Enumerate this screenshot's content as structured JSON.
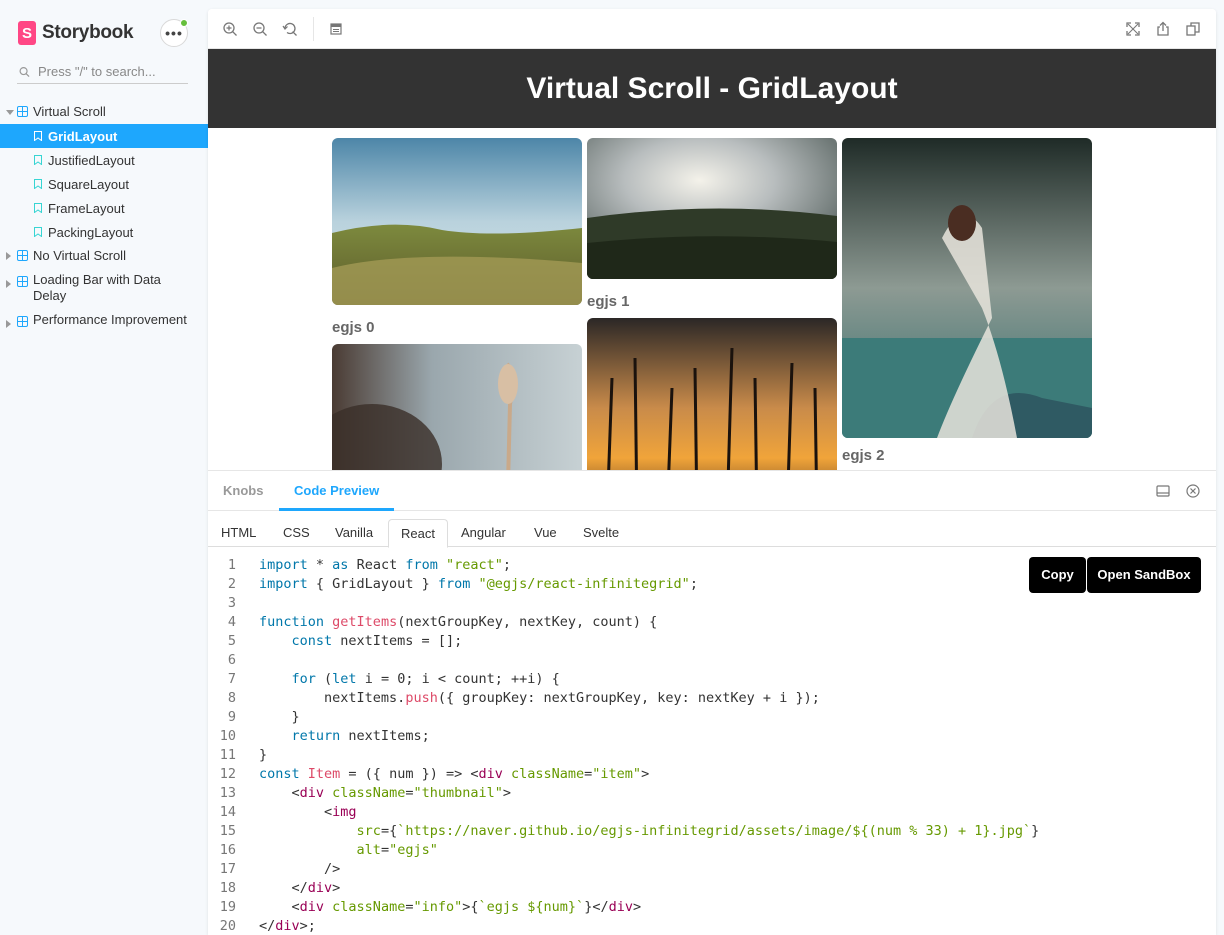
{
  "sidebar": {
    "brand": "Storybook",
    "brand_letter": "S",
    "menu_label": "•••",
    "search_placeholder": "Press \"/\" to search...",
    "groups": [
      {
        "label": "Virtual Scroll",
        "expanded": true,
        "stories": [
          "GridLayout",
          "JustifiedLayout",
          "SquareLayout",
          "FrameLayout",
          "PackingLayout"
        ]
      },
      {
        "label": "No Virtual Scroll",
        "expanded": false
      },
      {
        "label": "Loading Bar with Data Delay",
        "expanded": false
      },
      {
        "label": "Performance Improvement",
        "expanded": false
      }
    ],
    "active_story": "GridLayout"
  },
  "toolbar": {
    "left": [
      "zoom-in-icon",
      "zoom-out-icon",
      "zoom-reset-icon",
      "background-icon"
    ],
    "right": [
      "fullscreen-icon",
      "share-icon",
      "copy-link-icon"
    ]
  },
  "preview": {
    "title": "Virtual Scroll - GridLayout",
    "items": [
      {
        "info": "egjs 0"
      },
      {
        "info": "egjs 1"
      },
      {
        "info": "egjs 2"
      },
      {
        "info": ""
      },
      {
        "info": ""
      }
    ]
  },
  "addons": {
    "tabs": [
      "Knobs",
      "Code Preview"
    ],
    "active_tab": "Code Preview",
    "lang_tabs": [
      "HTML",
      "CSS",
      "Vanilla",
      "React",
      "Angular",
      "Vue",
      "Svelte"
    ],
    "active_lang": "React",
    "copy_label": "Copy",
    "sandbox_label": "Open SandBox",
    "code_lines": [
      "import * as React from \"react\";",
      "import { GridLayout } from \"@egjs/react-infinitegrid\";",
      "",
      "function getItems(nextGroupKey, nextKey, count) {",
      "    const nextItems = [];",
      "",
      "    for (let i = 0; i < count; ++i) {",
      "        nextItems.push({ groupKey: nextGroupKey, key: nextKey + i });",
      "    }",
      "    return nextItems;",
      "}",
      "const Item = ({ num }) => <div className=\"item\">",
      "    <div className=\"thumbnail\">",
      "        <img",
      "            src={`https://naver.github.io/egjs-infinitegrid/assets/image/${(num % 33) + 1}.jpg`}",
      "            alt=\"egjs\"",
      "        />",
      "    </div>",
      "    <div className=\"info\">{`egjs ${num}`}</div>",
      "</div>;"
    ]
  },
  "colors": {
    "accent": "#1ea7fd",
    "brand": "#ff4785",
    "status": "#66bf3c",
    "hero_bg": "#333333"
  }
}
